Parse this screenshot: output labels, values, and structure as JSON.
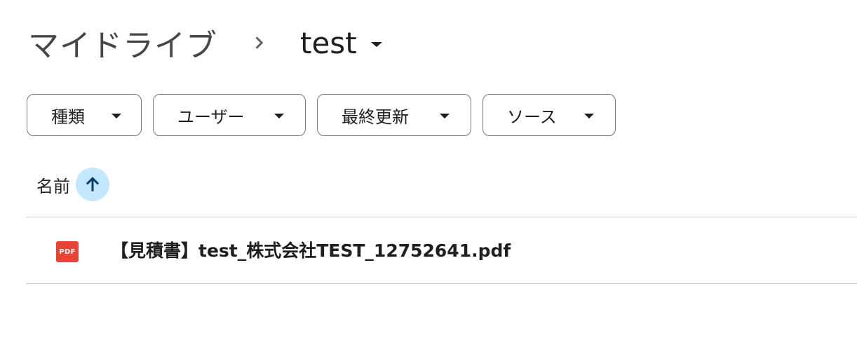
{
  "breadcrumb": {
    "root_label": "マイドライブ",
    "separator_icon": "chevron-right-icon",
    "current_label": "test",
    "current_menu_icon": "caret-down-icon"
  },
  "filters": [
    {
      "label": "種類",
      "icon": "caret-down-icon"
    },
    {
      "label": "ユーザー",
      "icon": "caret-down-icon"
    },
    {
      "label": "最終更新",
      "icon": "caret-down-icon"
    },
    {
      "label": "ソース",
      "icon": "caret-down-icon"
    }
  ],
  "list": {
    "column_name": "名前",
    "sort_icon": "arrow-up-icon",
    "sort_direction": "ascending",
    "rows": [
      {
        "file_type_icon": "pdf-icon",
        "icon_text": "PDF",
        "name": "【見積書】test_株式会社TEST_12752641.pdf"
      }
    ]
  },
  "colors": {
    "pdf_icon": "#ea4335",
    "sort_button_bg": "#c2e7ff",
    "sort_arrow": "#0b57d0",
    "chip_border": "#747775",
    "divider": "#c7c7c7"
  }
}
